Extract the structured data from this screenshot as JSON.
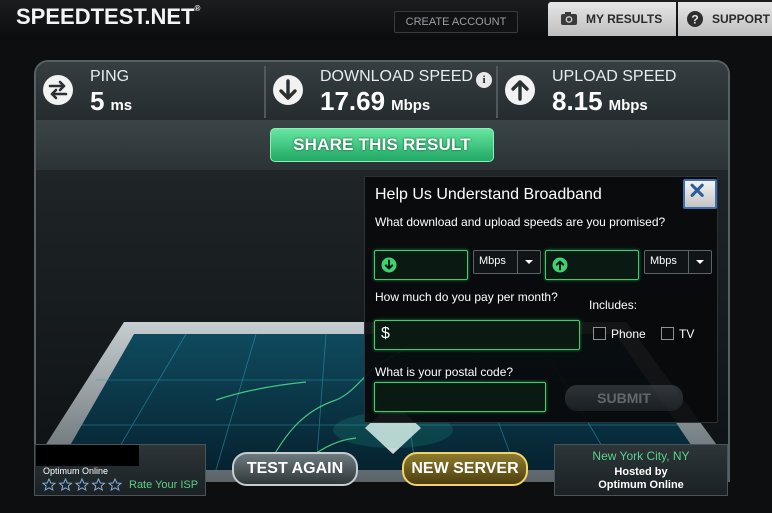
{
  "header": {
    "logo": "SPEEDTEST.NET",
    "create_account": "CREATE ACCOUNT",
    "my_results": "MY RESULTS",
    "support": "SUPPORT"
  },
  "stats": {
    "ping": {
      "label": "PING",
      "value": "5",
      "unit": "ms"
    },
    "download": {
      "label": "DOWNLOAD SPEED",
      "value": "17.69",
      "unit": "Mbps"
    },
    "upload": {
      "label": "UPLOAD SPEED",
      "value": "8.15",
      "unit": "Mbps"
    }
  },
  "share_button": "SHARE THIS RESULT",
  "survey": {
    "title": "Help Us Understand Broadband",
    "q_speeds": "What download and upload speeds are you promised?",
    "download_unit": "Mbps",
    "upload_unit": "Mbps",
    "q_pay": "How much do you pay per month?",
    "currency": "$",
    "includes_label": "Includes:",
    "phone_label": "Phone",
    "tv_label": "TV",
    "q_postal": "What is your postal code?",
    "submit": "SUBMIT"
  },
  "isp": {
    "name": "Optimum Online",
    "rate_label": "Rate Your ISP",
    "stars_total": 5,
    "stars_filled": 0
  },
  "buttons": {
    "test_again": "TEST AGAIN",
    "new_server": "NEW SERVER"
  },
  "server": {
    "city": "New York City, NY",
    "hosted_by": "Hosted by",
    "host": "Optimum Online"
  },
  "colors": {
    "accent_green": "#36d06c",
    "gold": "#f0d36a"
  }
}
